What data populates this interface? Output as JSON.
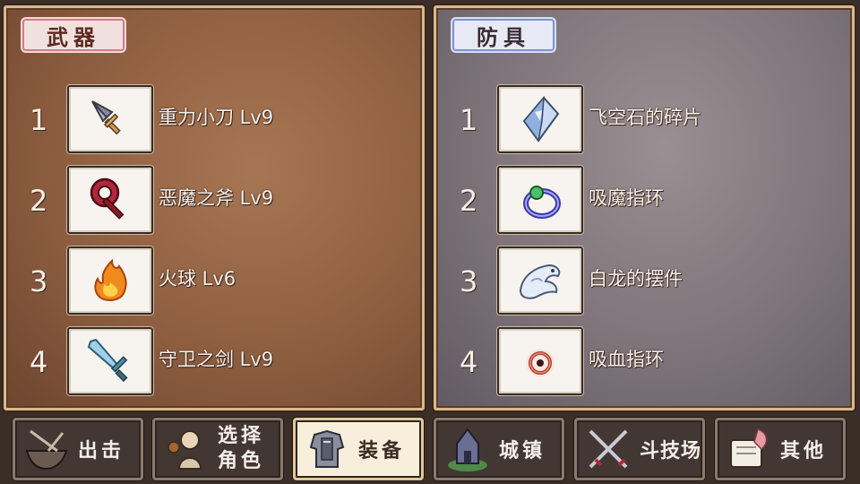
{
  "weapons": {
    "title": "武器",
    "items": [
      {
        "index": "1",
        "name": "重力小刀 Lv9",
        "icon": "dagger-icon"
      },
      {
        "index": "2",
        "name": "恶魔之斧 Lv9",
        "icon": "axe-icon"
      },
      {
        "index": "3",
        "name": "火球 Lv6",
        "icon": "fireball-icon"
      },
      {
        "index": "4",
        "name": "守卫之剑 Lv9",
        "icon": "sword-icon"
      }
    ]
  },
  "armor": {
    "title": "防具",
    "items": [
      {
        "index": "1",
        "name": "飞空石的碎片",
        "icon": "crystal-shard-icon"
      },
      {
        "index": "2",
        "name": "吸魔指环",
        "icon": "ring-icon"
      },
      {
        "index": "3",
        "name": "白龙的摆件",
        "icon": "dragon-ornament-icon"
      },
      {
        "index": "4",
        "name": "吸血指环",
        "icon": "blood-ring-icon"
      }
    ]
  },
  "nav": {
    "sortie": "出击",
    "select_line1": "选择",
    "select_line2": "角色",
    "equip": "装备",
    "town": "城镇",
    "arena": "斗技场",
    "other": "其他",
    "active": "equip"
  },
  "colors": {
    "weapon_panel": "#8e5e40",
    "armor_panel": "#7e7479",
    "active_button": "#f7efdc"
  }
}
